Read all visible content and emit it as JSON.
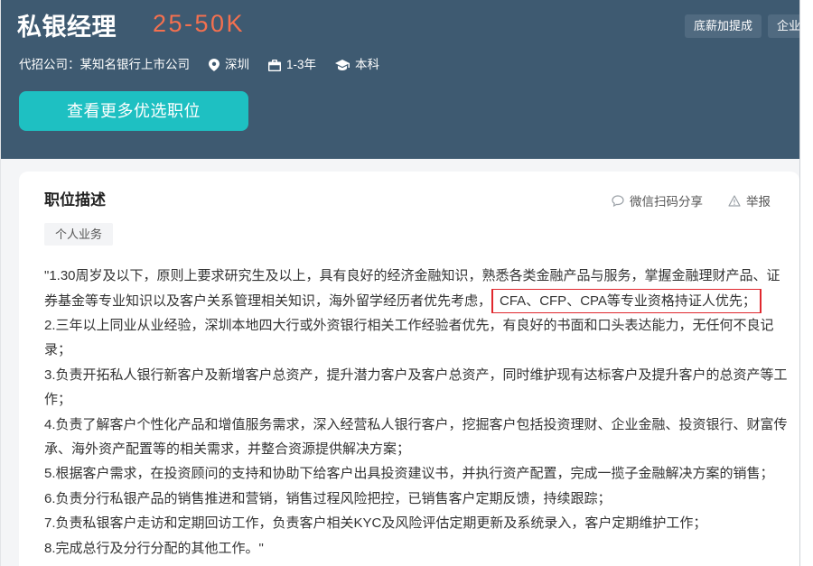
{
  "header": {
    "job_title": "私银经理",
    "salary": "25-50K",
    "benefit_tags": [
      "底薪加提成",
      "企业"
    ],
    "company_label": "代招公司：",
    "company_name": "某知名银行上市公司",
    "location": "深圳",
    "experience": "1-3年",
    "education": "本科",
    "cta_label": "查看更多优选职位"
  },
  "description": {
    "heading": "职位描述",
    "share_label": "微信扫码分享",
    "report_label": "举报",
    "category_tag": "个人业务",
    "lines": [
      "\"1.30周岁及以下，原则上要求研究生及以上，具有良好的经济金融知识，熟悉各类金融产品与服务，掌握金融理财产品、证",
      "券基金等专业知识以及客户关系管理相关知识，海外留学经历者优先考虑，",
      "2.三年以上同业从业经验，深圳本地四大行或外资银行相关工作经验者优先，有良好的书面和口头表达能力，无任何不良记",
      "录；",
      "3.负责开拓私人银行新客户及新增客户总资产，提升潜力客户及客户总资产，同时维护现有达标客户及提升客户的总资产等工",
      "作；",
      "4.负责了解客户个性化产品和增值服务需求，深入经营私人银行客户，挖掘客户包括投资理财、企业金融、投资银行、财富传",
      "承、海外资产配置等的相关需求，并整合资源提供解决方案；",
      "5.根据客户需求，在投资顾问的支持和协助下给客户出具投资建议书，并执行资产配置，完成一揽子金融解决方案的销售；",
      "6.负责分行私银产品的销售推进和营销，销售过程风险把控，已销售客户定期反馈，持续跟踪；",
      "7.负责私银客户走访和定期回访工作，负责客户相关KYC及风险评估定期更新及系统录入，客户定期维护工作；",
      "8.完成总行及分行分配的其他工作。\""
    ],
    "highlighted_text": "CFA、CFP、CPA等专业资格持证人优先；"
  },
  "icons": {
    "location": "location-pin-icon",
    "experience": "briefcase-icon",
    "education": "graduation-cap-icon",
    "share": "chat-bubble-icon",
    "report": "warning-icon"
  },
  "colors": {
    "header_bg": "#3e5a71",
    "salary": "#f4704f",
    "cta_bg": "#1ec0c2",
    "highlight_border": "#e0282e"
  }
}
